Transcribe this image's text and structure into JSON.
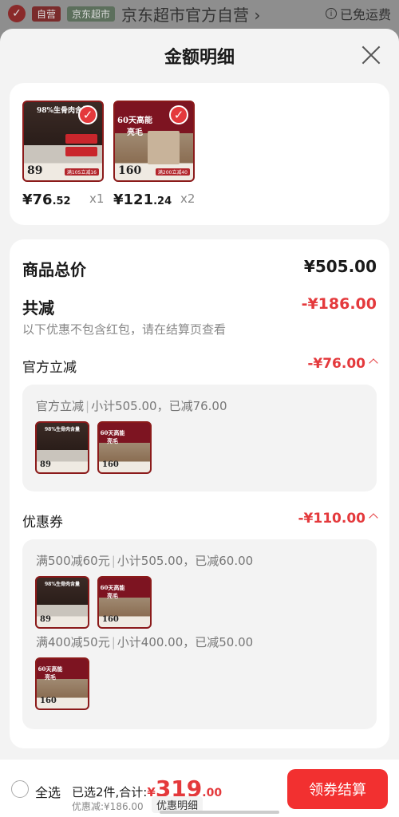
{
  "background": {
    "badge_self": "自营",
    "badge_market": "京东超市",
    "store_name": "京东超市官方自营 ›",
    "free_shipping": "已免运费"
  },
  "sheet": {
    "title": "金额明细"
  },
  "products": [
    {
      "image_top": "98%生骨肉含量",
      "image_price": "89",
      "image_tag": "满10S立减16",
      "price_yen": "¥76",
      "price_dec": ".52",
      "qty": "x1"
    },
    {
      "image_top": "60天高能亮毛",
      "image_price": "160",
      "image_tag": "满200立减40",
      "price_yen": "¥121",
      "price_dec": ".24",
      "qty": "x2"
    }
  ],
  "details": {
    "total_label": "商品总价",
    "total_value": "¥505.00",
    "reduce_label": "共减",
    "reduce_value": "-¥186.00",
    "reduce_note": "以下优惠不包含红包，请在结算页查看",
    "official": {
      "label": "官方立减",
      "value": "-¥76.00",
      "line_title": "官方立减",
      "line_rest": "小计505.00，已减76.00"
    },
    "coupon": {
      "label": "优惠券",
      "value": "-¥110.00",
      "line1_title": "满500减60元",
      "line1_rest": "小计505.00，已减60.00",
      "line2_title": "满400减50元",
      "line2_rest": "小计400.00，已减50.00"
    }
  },
  "bottom": {
    "select_all": "全选",
    "selected_total": "已选2件,合计:",
    "yen": "¥",
    "amount_int": "319",
    "amount_dec": ".00",
    "discount": "优惠减:¥186.00",
    "detail_button": "优惠明细",
    "checkout_button": "领券结算"
  },
  "colors": {
    "accent": "#e4393c",
    "checkout": "#f23030"
  }
}
